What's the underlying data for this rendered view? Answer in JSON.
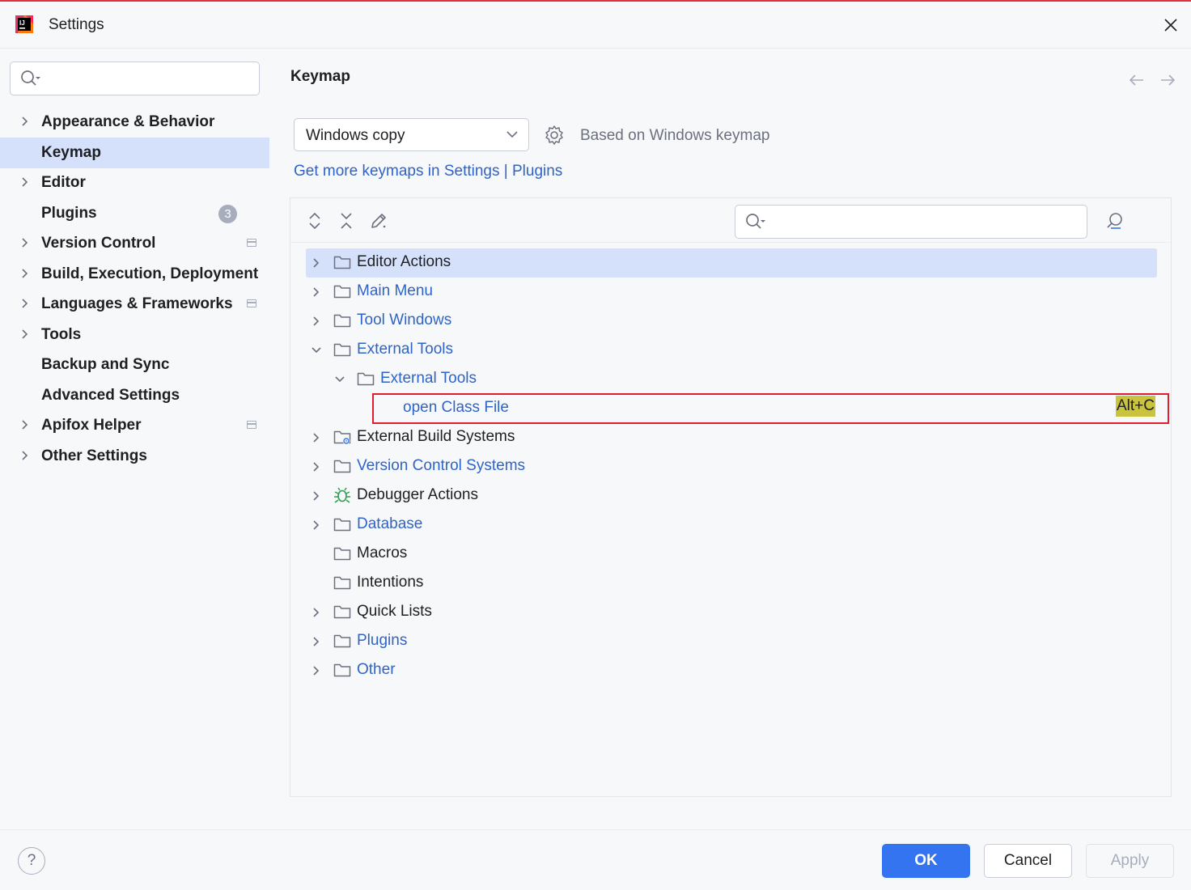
{
  "window": {
    "title": "Settings"
  },
  "search": {
    "sidebar_placeholder": "",
    "tree_placeholder": ""
  },
  "sidebar": {
    "items": [
      {
        "label": "Appearance & Behavior",
        "expandable": true,
        "selected": false,
        "badge": "",
        "project_icon": false
      },
      {
        "label": "Keymap",
        "expandable": false,
        "selected": true,
        "badge": "",
        "project_icon": false
      },
      {
        "label": "Editor",
        "expandable": true,
        "selected": false,
        "badge": "",
        "project_icon": false
      },
      {
        "label": "Plugins",
        "expandable": false,
        "selected": false,
        "badge": "3",
        "project_icon": false
      },
      {
        "label": "Version Control",
        "expandable": true,
        "selected": false,
        "badge": "",
        "project_icon": true
      },
      {
        "label": "Build, Execution, Deployment",
        "expandable": true,
        "selected": false,
        "badge": "",
        "project_icon": false
      },
      {
        "label": "Languages & Frameworks",
        "expandable": true,
        "selected": false,
        "badge": "",
        "project_icon": true
      },
      {
        "label": "Tools",
        "expandable": true,
        "selected": false,
        "badge": "",
        "project_icon": false
      },
      {
        "label": "Backup and Sync",
        "expandable": false,
        "selected": false,
        "badge": "",
        "project_icon": false
      },
      {
        "label": "Advanced Settings",
        "expandable": false,
        "selected": false,
        "badge": "",
        "project_icon": false
      },
      {
        "label": "Apifox Helper",
        "expandable": true,
        "selected": false,
        "badge": "",
        "project_icon": true
      },
      {
        "label": "Other Settings",
        "expandable": true,
        "selected": false,
        "badge": "",
        "project_icon": false
      }
    ]
  },
  "main": {
    "title": "Keymap",
    "keymap_select": "Windows copy",
    "based_on": "Based on Windows keymap",
    "get_more_link": "Get more keymaps in Settings | Plugins"
  },
  "tree": {
    "rows": [
      {
        "label": "Editor Actions",
        "depth": 0,
        "chevron": "right",
        "icon": "folder",
        "color": "dark",
        "selected": true,
        "shortcut": ""
      },
      {
        "label": "Main Menu",
        "depth": 0,
        "chevron": "right",
        "icon": "folder",
        "color": "blue",
        "selected": false,
        "shortcut": ""
      },
      {
        "label": "Tool Windows",
        "depth": 0,
        "chevron": "right",
        "icon": "folder",
        "color": "blue",
        "selected": false,
        "shortcut": ""
      },
      {
        "label": "External Tools",
        "depth": 0,
        "chevron": "down",
        "icon": "folder",
        "color": "blue",
        "selected": false,
        "shortcut": ""
      },
      {
        "label": "External Tools",
        "depth": 1,
        "chevron": "down",
        "icon": "folder",
        "color": "blue",
        "selected": false,
        "shortcut": ""
      },
      {
        "label": "open Class File",
        "depth": 2,
        "chevron": "none",
        "icon": "none",
        "color": "blue",
        "selected": false,
        "shortcut": "Alt+C"
      },
      {
        "label": "External Build Systems",
        "depth": 0,
        "chevron": "right",
        "icon": "folder-gear",
        "color": "dark",
        "selected": false,
        "shortcut": ""
      },
      {
        "label": "Version Control Systems",
        "depth": 0,
        "chevron": "right",
        "icon": "folder",
        "color": "blue",
        "selected": false,
        "shortcut": ""
      },
      {
        "label": "Debugger Actions",
        "depth": 0,
        "chevron": "right",
        "icon": "bug",
        "color": "dark",
        "selected": false,
        "shortcut": ""
      },
      {
        "label": "Database",
        "depth": 0,
        "chevron": "right",
        "icon": "folder",
        "color": "blue",
        "selected": false,
        "shortcut": ""
      },
      {
        "label": "Macros",
        "depth": 0,
        "chevron": "none",
        "icon": "folder",
        "color": "dark",
        "selected": false,
        "shortcut": ""
      },
      {
        "label": "Intentions",
        "depth": 0,
        "chevron": "none",
        "icon": "folder",
        "color": "dark",
        "selected": false,
        "shortcut": ""
      },
      {
        "label": "Quick Lists",
        "depth": 0,
        "chevron": "right",
        "icon": "folder",
        "color": "dark",
        "selected": false,
        "shortcut": ""
      },
      {
        "label": "Plugins",
        "depth": 0,
        "chevron": "right",
        "icon": "folder",
        "color": "blue",
        "selected": false,
        "shortcut": ""
      },
      {
        "label": "Other",
        "depth": 0,
        "chevron": "right",
        "icon": "folder",
        "color": "blue",
        "selected": false,
        "shortcut": ""
      }
    ]
  },
  "buttons": {
    "ok": "OK",
    "cancel": "Cancel",
    "apply": "Apply",
    "help": "?"
  },
  "colors": {
    "accent": "#3574f0",
    "selection": "#d5e0fb",
    "link": "#2e64c8",
    "highlight": "#c9c33e",
    "annotation_box": "#e01e2d",
    "debugger_icon": "#2e9e4f"
  }
}
